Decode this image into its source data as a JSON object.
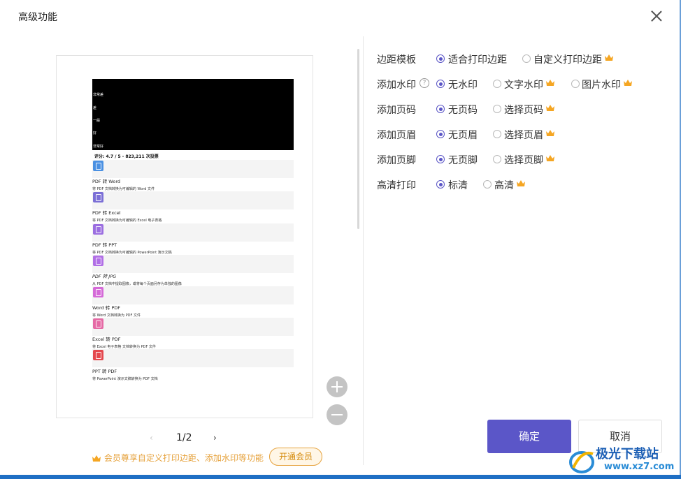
{
  "dialog": {
    "title": "高级功能"
  },
  "preview": {
    "black_lines": [
      "非常差",
      "差",
      "一般",
      "好",
      "非常好"
    ],
    "rating": "评分: 4.7 / 5 - 823,211 次投票",
    "items": [
      {
        "title": "PDF 转 Word",
        "desc": "将 PDF 文档转换为可编辑的 Word 文件",
        "color": "#4a90e2"
      },
      {
        "title": "PDF 转 Excel",
        "desc": "将 PDF 文档转换为可编辑的 Excel 电子表格",
        "color": "#7b6fd6"
      },
      {
        "title": "PDF 转 PPT",
        "desc": "将 PDF 文档转换为可编辑的 PowerPoint 演示文稿",
        "color": "#9b6ee0"
      },
      {
        "title": "PDF 转 JPG",
        "desc": "从 PDF 文档中提取图像，或将每个页面另存为单独的图像",
        "color": "#b16fe6"
      },
      {
        "title": "Word 转 PDF",
        "desc": "将 Word 文档转换为 PDF 文件",
        "color": "#d56ad8"
      },
      {
        "title": "Excel 转 PDF",
        "desc": "将 Excel 电子表格 文档转换为 PDF 文件",
        "color": "#e56aa5"
      },
      {
        "title": "PPT 转 PDF",
        "desc": "将 PowerPoint 演示文稿转换为 PDF 文档",
        "color": "#e4484e"
      }
    ],
    "page_indicator": "1/2"
  },
  "promo": {
    "text": "会员尊享自定义打印边距、添加水印等功能",
    "button": "开通会员"
  },
  "settings": [
    {
      "label": "边距模板",
      "options": [
        {
          "label": "适合打印边距",
          "selected": true,
          "vip": false
        },
        {
          "label": "自定义打印边距",
          "selected": false,
          "vip": true
        }
      ]
    },
    {
      "label": "添加水印",
      "help": "?",
      "options": [
        {
          "label": "无水印",
          "selected": true,
          "vip": false
        },
        {
          "label": "文字水印",
          "selected": false,
          "vip": true
        },
        {
          "label": "图片水印",
          "selected": false,
          "vip": true
        }
      ]
    },
    {
      "label": "添加页码",
      "options": [
        {
          "label": "无页码",
          "selected": true,
          "vip": false
        },
        {
          "label": "选择页码",
          "selected": false,
          "vip": true
        }
      ]
    },
    {
      "label": "添加页眉",
      "options": [
        {
          "label": "无页眉",
          "selected": true,
          "vip": false
        },
        {
          "label": "选择页眉",
          "selected": false,
          "vip": true
        }
      ]
    },
    {
      "label": "添加页脚",
      "options": [
        {
          "label": "无页脚",
          "selected": true,
          "vip": false
        },
        {
          "label": "选择页脚",
          "selected": false,
          "vip": true
        }
      ]
    },
    {
      "label": "高清打印",
      "options": [
        {
          "label": "标清",
          "selected": true,
          "vip": false
        },
        {
          "label": "高清",
          "selected": false,
          "vip": true
        }
      ]
    }
  ],
  "actions": {
    "confirm": "确定",
    "cancel": "取消"
  },
  "watermark": {
    "site_name": "极光下载站",
    "url": "www.xz7.com"
  },
  "colors": {
    "accent": "#5b56c8",
    "vip": "#f5a623"
  }
}
